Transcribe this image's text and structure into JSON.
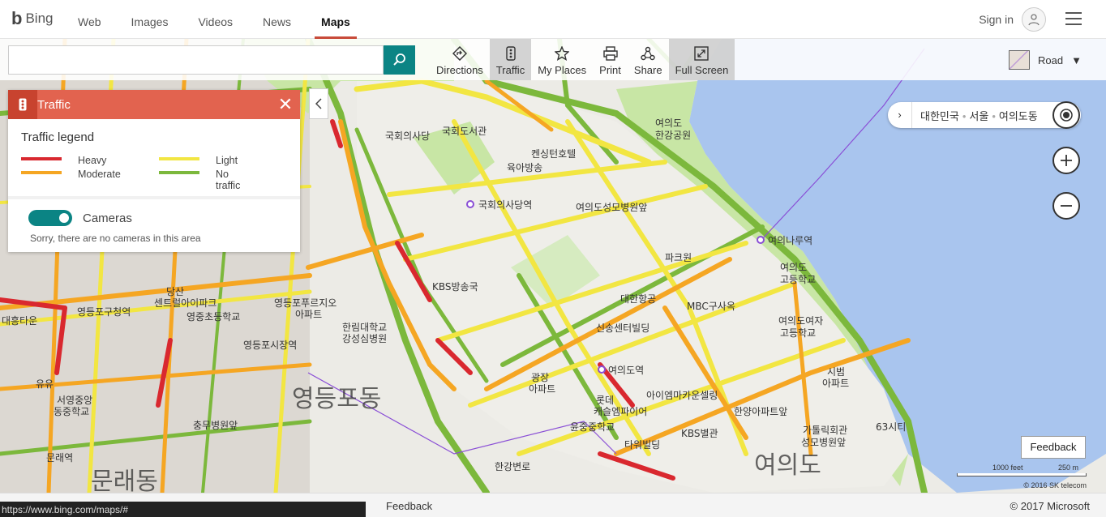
{
  "header": {
    "logo_text": "Bing",
    "nav": [
      "Web",
      "Images",
      "Videos",
      "News",
      "Maps"
    ],
    "active_nav": "Maps",
    "signin": "Sign in"
  },
  "toolbar": {
    "search_value": "",
    "tools": [
      {
        "label": "Directions",
        "icon": "directions-icon"
      },
      {
        "label": "Traffic",
        "icon": "traffic-icon",
        "active": true
      },
      {
        "label": "My Places",
        "icon": "star-icon"
      },
      {
        "label": "Print",
        "icon": "print-icon"
      },
      {
        "label": "Share",
        "icon": "share-icon"
      },
      {
        "label": "Full Screen",
        "icon": "fullscreen-icon",
        "active": true
      }
    ],
    "map_type": "Road"
  },
  "traffic_panel": {
    "title": "Traffic",
    "legend_title": "Traffic legend",
    "legend": [
      {
        "label": "Heavy",
        "color": "#d9282f"
      },
      {
        "label": "Moderate",
        "color": "#f5a623"
      },
      {
        "label": "Light",
        "color": "#f2e642"
      },
      {
        "label": "No traffic",
        "color": "#7cb83c"
      }
    ],
    "cameras_label": "Cameras",
    "cameras_on": true,
    "cameras_note": "Sorry, there are no cameras in this area"
  },
  "location": {
    "country": "대한민국",
    "city": "서울",
    "district": "여의도동"
  },
  "map_labels": {
    "assembly": "국회의사당",
    "assembly_library": "국회도서관",
    "kensington": "켄싱턴호텔",
    "yeouido_park_1": "여의도",
    "yeouido_park_2": "한강공원",
    "broadcasting": "육아방송",
    "assembly_station": "국회의사당역",
    "hospital": "여의도성모병원앞",
    "kbs": "KBS방송국",
    "yeouinaru": "여의나루역",
    "school_1": "여의도",
    "school_2": "고등학교",
    "parkone": "파크원",
    "daehan": "대한항공",
    "mbc": "MBC구사옥",
    "girls_1": "여의도여자",
    "girls_2": "고등학교",
    "yeouido_station": "여의도역",
    "lotte_1": "롯데",
    "lotte_2": "캐슬엠파이어",
    "ifc": "아이엠마카운셀링",
    "kbs_annex": "KBS별관",
    "hanyang": "한양아파트앞",
    "catholic_1": "가톨릭회관",
    "catholic_2": "성모병원앞",
    "sibum_1": "시범",
    "sibum_2": "아파트",
    "building63": "63시티",
    "yeouido_big": "여의도",
    "yeongdeungpo_market": "영등포시장역",
    "yeongdeungpo_big": "영등포동",
    "mullae": "문래동",
    "mullae_station": "문래역",
    "yeongdeungpo_office": "영등포구청역",
    "dangsan_1": "당산",
    "dangsan_2": "센트럴아이파크",
    "dangsan_3": "영중초등학교",
    "yeongdeungpo_apt_1": "영등포푸르지오",
    "yeongdeungpo_apt_2": "아파트",
    "daehan_tower": "대흥타운",
    "yuyu": "유유",
    "mullae_school_1": "서영중앙",
    "mullae_school_2": "동중학교",
    "chungmu": "충무병원앞",
    "hallym": "한림대학교",
    "hallym_2": "강성심병원",
    "sinsegye": "신송센터빌딩",
    "gwangjang": "광장",
    "gwangjang_2": "아파트",
    "yunjung": "윤중중학교",
    "taeyoung": "타워빌딩",
    "riverside": "한강변로"
  },
  "feedback_button": "Feedback",
  "scale": {
    "feet": "1000 feet",
    "meters": "250 m"
  },
  "map_copyright": "© 2016 SK telecom",
  "footer": {
    "status_url": "https://www.bing.com/maps/#",
    "feedback": "Feedback",
    "copyright": "© 2017 Microsoft"
  },
  "colors": {
    "accent": "#0b8484",
    "traffic_header": "#e2634f",
    "river": "#a9c5ee",
    "park": "#c8e6a5"
  }
}
